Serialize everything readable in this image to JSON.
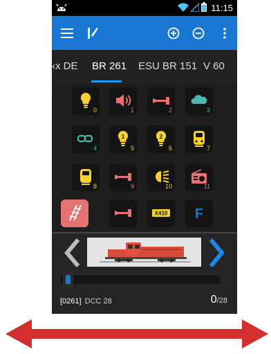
{
  "status_bar": {
    "time": "11:15",
    "app_icon": "android-robot-icon",
    "icons": [
      "wifi-icon",
      "cell-signal-icon",
      "battery-icon"
    ]
  },
  "toolbar": {
    "icons": [
      "menu-icon",
      "app-logo-icon",
      "add-circle-icon",
      "remove-circle-icon",
      "more-vert-icon"
    ]
  },
  "tabs": [
    {
      "label": "‹x DE",
      "active": false
    },
    {
      "label": "BR 261",
      "active": true
    },
    {
      "label": "ESU BR 151",
      "active": false
    },
    {
      "label": "V 60",
      "active": false
    }
  ],
  "functions": [
    {
      "number": "0",
      "icon": "light-bulb-icon",
      "color": "#f5d132"
    },
    {
      "number": "1",
      "icon": "speaker-icon",
      "color": "#e57373"
    },
    {
      "number": "2",
      "icon": "horn-icon",
      "color": "#e57373"
    },
    {
      "number": "3",
      "icon": "cloud-icon",
      "color": "#4db6ac"
    },
    {
      "number": "4",
      "icon": "coupler-icon",
      "color": "#4db6ac"
    },
    {
      "number": "5",
      "icon": "light-bulb-1-icon",
      "color": "#f5d132"
    },
    {
      "number": "6",
      "icon": "light-bulb-2-icon",
      "color": "#f5d132"
    },
    {
      "number": "7",
      "icon": "cab-light-icon",
      "color": "#f5d132"
    },
    {
      "number": "8",
      "icon": "cab-light-2-icon",
      "color": "#f5d132"
    },
    {
      "number": "9",
      "icon": "horn-icon",
      "color": "#e57373"
    },
    {
      "number": "10",
      "icon": "headlight-icon",
      "color": "#f5d132"
    },
    {
      "number": "11",
      "icon": "radio-icon",
      "color": "#e57373"
    },
    {
      "number": "",
      "icon": "track-icon",
      "color": "#e57373"
    },
    {
      "number": "",
      "icon": "horn-icon",
      "color": "#e57373"
    },
    {
      "number": "",
      "icon": "x410-icon",
      "color": "#f5d132",
      "label": "X410"
    },
    {
      "number": "",
      "icon": "f-icon",
      "color": "#1976d2",
      "label": "F"
    }
  ],
  "loco": {
    "address": "[0261]",
    "protocol": "DCC 28",
    "speed_current": "0",
    "speed_sep": "/",
    "speed_max": "28",
    "speed_level": 0,
    "image": "red-diesel-locomotive"
  },
  "swipe_indicator": "double-arrow-icon",
  "colors": {
    "toolbar": "#1976d2",
    "accent": "#2196f3",
    "background": "#1e1e1e",
    "swipe_arrow": "#d32f2f"
  }
}
